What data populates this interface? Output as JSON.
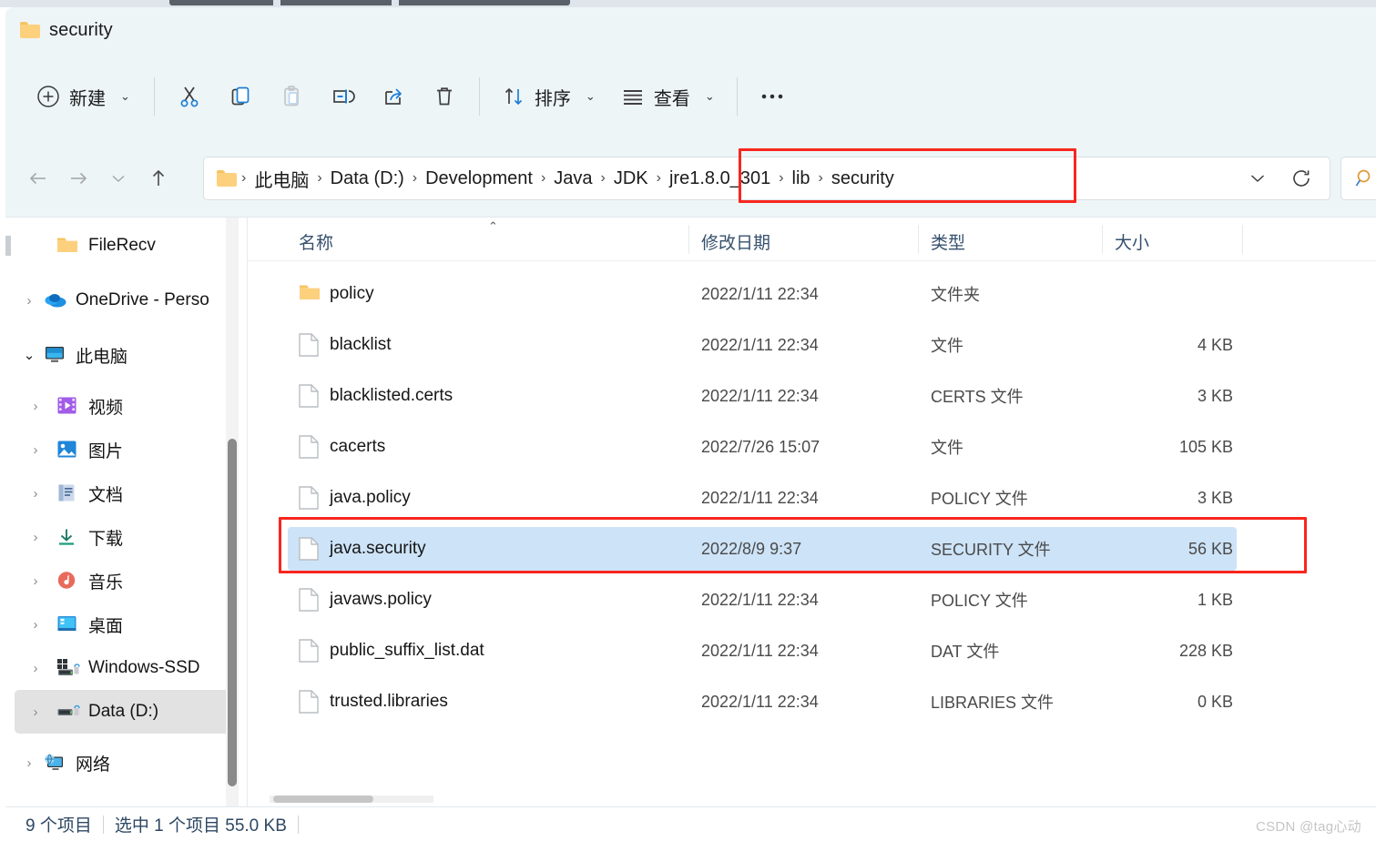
{
  "window": {
    "title": "security",
    "title_icon": "folder-icon"
  },
  "toolbar": {
    "new_label": "新建",
    "new_icon": "plus-circle-icon",
    "cut_icon": "scissors-icon",
    "copy_icon": "copy-icon",
    "paste_icon": "paste-icon",
    "rename_icon": "rename-icon",
    "share_icon": "share-icon",
    "delete_icon": "trash-icon",
    "sort_label": "排序",
    "sort_icon": "sort-arrows-icon",
    "view_label": "查看",
    "view_icon": "list-lines-icon",
    "more_icon": "ellipsis-icon",
    "chevron": "⌄"
  },
  "addressbar": {
    "back_icon": "arrow-left-icon",
    "forward_icon": "arrow-right-icon",
    "recent_icon": "chevron-down-icon",
    "up_icon": "arrow-up-icon",
    "folder_icon": "folder-icon",
    "crumbs": [
      "此电脑",
      "Data (D:)",
      "Development",
      "Java",
      "JDK",
      "jre1.8.0_301",
      "lib",
      "security"
    ],
    "separator": "›",
    "dropdown_icon": "chevron-down-icon",
    "refresh_icon": "refresh-icon",
    "search_icon": "search-icon",
    "search_placeholder": ""
  },
  "annotations": {
    "color": "#f8261e",
    "breadcrumb_box": "jre1.8.0_301 › lib › security",
    "row_box": "java.security"
  },
  "sidebar": {
    "items": [
      {
        "label": "FileRecv",
        "icon": "folder-icon",
        "chevron": "",
        "level": 2,
        "selected": false
      },
      {
        "label": "OneDrive - Perso",
        "icon": "onedrive-icon",
        "chevron": "›",
        "level": 1,
        "selected": false
      },
      {
        "label": "此电脑",
        "icon": "this-pc-icon",
        "chevron": "⌄",
        "level": 1,
        "selected": false
      },
      {
        "label": "视频",
        "icon": "videos-icon",
        "chevron": "›",
        "level": 2,
        "selected": false
      },
      {
        "label": "图片",
        "icon": "pictures-icon",
        "chevron": "›",
        "level": 2,
        "selected": false
      },
      {
        "label": "文档",
        "icon": "documents-icon",
        "chevron": "›",
        "level": 2,
        "selected": false
      },
      {
        "label": "下载",
        "icon": "downloads-icon",
        "chevron": "›",
        "level": 2,
        "selected": false
      },
      {
        "label": "音乐",
        "icon": "music-icon",
        "chevron": "›",
        "level": 2,
        "selected": false
      },
      {
        "label": "桌面",
        "icon": "desktop-icon",
        "chevron": "›",
        "level": 2,
        "selected": false
      },
      {
        "label": "Windows-SSD",
        "icon": "windows-drive-icon",
        "chevron": "›",
        "level": 2,
        "selected": false
      },
      {
        "label": "Data (D:)",
        "icon": "drive-icon",
        "chevron": "›",
        "level": 2,
        "selected": true
      },
      {
        "label": "网络",
        "icon": "network-icon",
        "chevron": "›",
        "level": 1,
        "selected": false
      }
    ]
  },
  "filelist": {
    "columns": [
      {
        "key": "name",
        "label": "名称",
        "sorted": "asc"
      },
      {
        "key": "date",
        "label": "修改日期",
        "sorted": ""
      },
      {
        "key": "type",
        "label": "类型",
        "sorted": ""
      },
      {
        "key": "size",
        "label": "大小",
        "sorted": ""
      }
    ],
    "sort_caret": "⌃",
    "rows": [
      {
        "name": "policy",
        "date": "2022/1/11 22:34",
        "type": "文件夹",
        "size": "",
        "icon": "folder-icon",
        "selected": false
      },
      {
        "name": "blacklist",
        "date": "2022/1/11 22:34",
        "type": "文件",
        "size": "4 KB",
        "icon": "document-icon",
        "selected": false
      },
      {
        "name": "blacklisted.certs",
        "date": "2022/1/11 22:34",
        "type": "CERTS 文件",
        "size": "3 KB",
        "icon": "document-icon",
        "selected": false
      },
      {
        "name": "cacerts",
        "date": "2022/7/26 15:07",
        "type": "文件",
        "size": "105 KB",
        "icon": "document-icon",
        "selected": false
      },
      {
        "name": "java.policy",
        "date": "2022/1/11 22:34",
        "type": "POLICY 文件",
        "size": "3 KB",
        "icon": "document-icon",
        "selected": false
      },
      {
        "name": "java.security",
        "date": "2022/8/9 9:37",
        "type": "SECURITY 文件",
        "size": "56 KB",
        "icon": "document-icon",
        "selected": true
      },
      {
        "name": "javaws.policy",
        "date": "2022/1/11 22:34",
        "type": "POLICY 文件",
        "size": "1 KB",
        "icon": "document-icon",
        "selected": false
      },
      {
        "name": "public_suffix_list.dat",
        "date": "2022/1/11 22:34",
        "type": "DAT 文件",
        "size": "228 KB",
        "icon": "document-icon",
        "selected": false
      },
      {
        "name": "trusted.libraries",
        "date": "2022/1/11 22:34",
        "type": "LIBRARIES 文件",
        "size": "0 KB",
        "icon": "document-icon",
        "selected": false
      }
    ]
  },
  "statusbar": {
    "item_count": "9 个项目",
    "selection": "选中 1 个项目  55.0 KB"
  },
  "watermark": {
    "text": "CSDN @tag心动"
  },
  "colors": {
    "chrome_bg": "#eef5f7",
    "selection_blue": "#cde3f7",
    "annotation_red": "#f8261e",
    "header_text": "#36506e",
    "accent_blue": "#1c7ed6"
  }
}
